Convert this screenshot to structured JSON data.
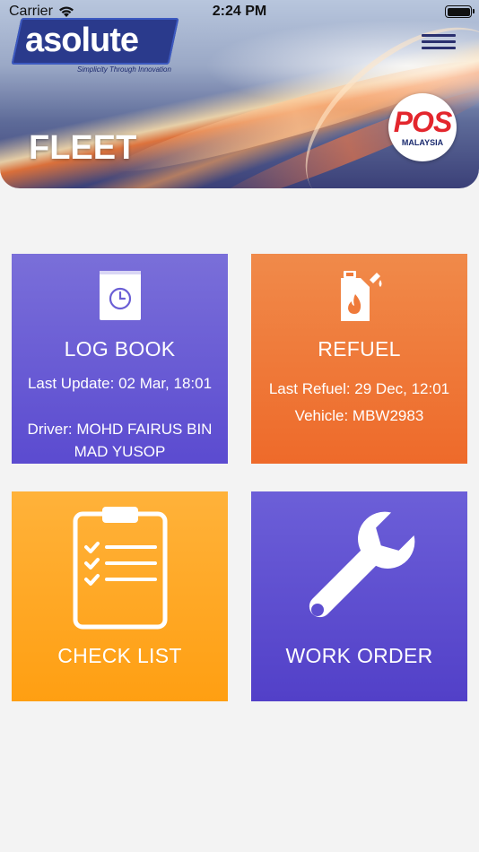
{
  "status_bar": {
    "carrier": "Carrier",
    "time": "2:24 PM"
  },
  "header": {
    "logo_text": "asolute",
    "logo_tagline": "Simplicity Through Innovation",
    "title": "FLEET",
    "partner_logo": "POS",
    "partner_subtext": "MALAYSIA"
  },
  "tiles": {
    "log_book": {
      "title": "LOG BOOK",
      "last_update": "Last Update: 02 Mar, 18:01",
      "driver": "Driver: MOHD FAIRUS BIN MAD YUSOP",
      "icon": "book-clock-icon"
    },
    "refuel": {
      "title": "REFUEL",
      "last_refuel": "Last Refuel: 29 Dec, 12:01",
      "vehicle": "Vehicle: MBW2983",
      "icon": "fuel-canister-icon"
    },
    "check_list": {
      "title": "CHECK LIST",
      "icon": "clipboard-checklist-icon"
    },
    "work_order": {
      "title": "WORK ORDER",
      "icon": "wrench-icon"
    }
  },
  "colors": {
    "log_book": "#6a5ed5",
    "refuel": "#ef7a3a",
    "check_list": "#ffa923",
    "work_order": "#5e4fd0",
    "background": "#f3f3f3"
  }
}
